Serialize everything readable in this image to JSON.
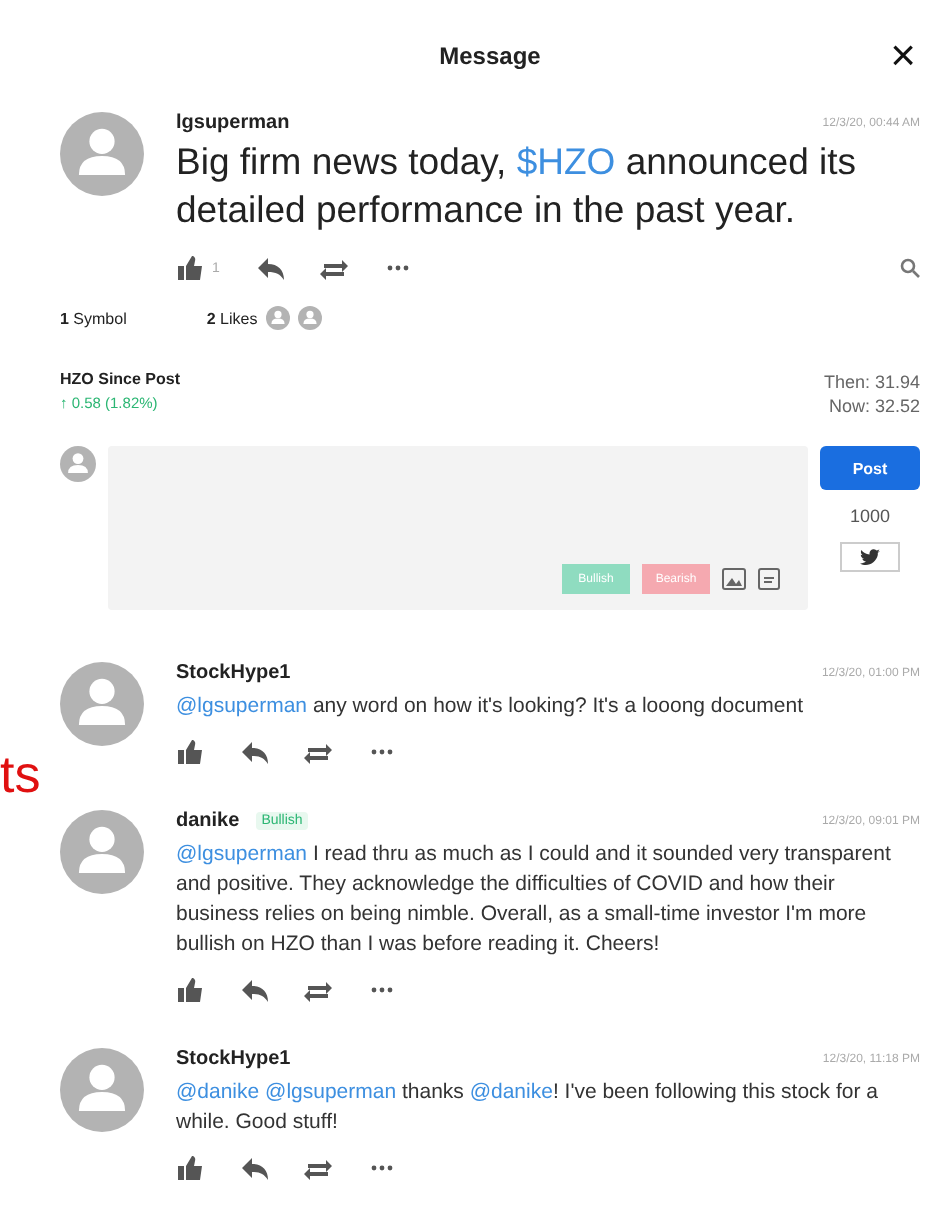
{
  "header": {
    "title": "Message",
    "close": "×"
  },
  "side_label": "ts",
  "post": {
    "author": "lgsuperman",
    "time": "12/3/20, 00:44 AM",
    "like_count": "1",
    "text": [
      {
        "kind": "plain",
        "text": "Big firm news today, "
      },
      {
        "kind": "link",
        "text": "$HZO"
      },
      {
        "kind": "plain",
        "text": " announced its detailed performance in the past year."
      }
    ]
  },
  "stats": [
    {
      "count": "1",
      "label": "Symbol"
    },
    {
      "count": "2",
      "label": "Likes"
    }
  ],
  "stock": {
    "title": "HZO Since Post",
    "change": "↑ 0.58 (1.82%)",
    "then": "Then: 31.94",
    "now": "Now: 32.52"
  },
  "composer": {
    "tags": [
      {
        "label": "Bullish",
        "color": "#8fdcc0"
      },
      {
        "label": "Bearish",
        "color": "#f5a9b0"
      }
    ],
    "post_button": "Post",
    "char_count": "1000"
  },
  "comments": [
    {
      "author": "StockHype1",
      "time": "12/3/20, 01:00 PM",
      "text": [
        {
          "kind": "link",
          "text": "@lgsuperman"
        },
        {
          "kind": "plain",
          "text": " any word on how it's looking? It's a looong document"
        }
      ]
    },
    {
      "author": "danike",
      "badge": "Bullish",
      "time": "12/3/20, 09:01 PM",
      "text": [
        {
          "kind": "link",
          "text": "@lgsuperman"
        },
        {
          "kind": "plain",
          "text": " I read thru as much as I could and it sounded very transparent and positive.  They acknowledge the difficulties of COVID and how their business relies on being nimble.  Overall, as a small-time investor I'm more bullish on HZO than I was before reading it.  Cheers!"
        }
      ]
    },
    {
      "author": "StockHype1",
      "time": "12/3/20, 11:18 PM",
      "text": [
        {
          "kind": "link",
          "text": "@danike"
        },
        {
          "kind": "link",
          "text": "@lgsuperman"
        },
        {
          "kind": "plain",
          "text": " thanks "
        },
        {
          "kind": "link",
          "text": "@danike"
        },
        {
          "kind": "plain",
          "text": "! I've been following this stock for a while. Good stuff!"
        }
      ]
    }
  ]
}
